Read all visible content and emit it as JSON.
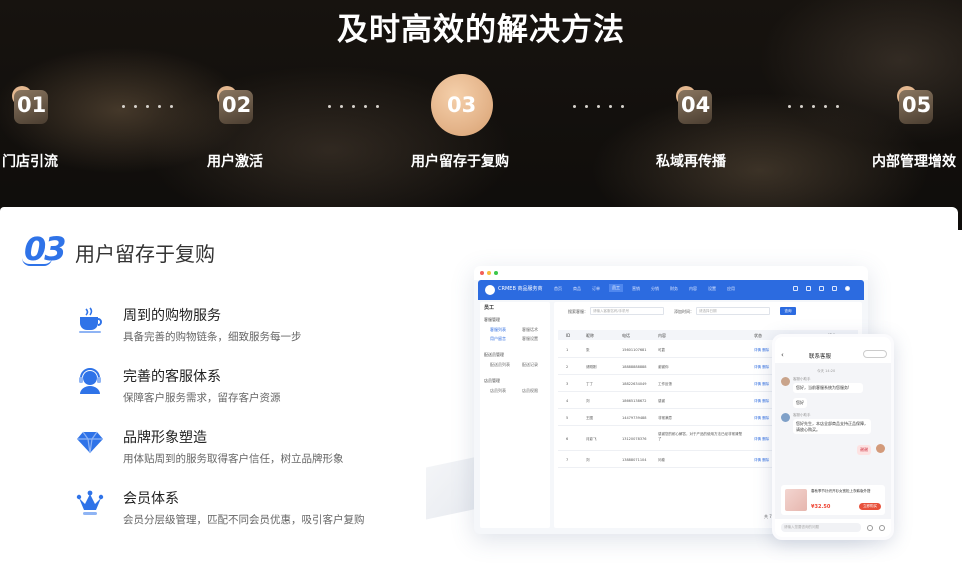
{
  "hero": {
    "title": "及时高效的解决方法",
    "steps": [
      {
        "num": "01",
        "label": "门店引流",
        "active": false
      },
      {
        "num": "02",
        "label": "用户激活",
        "active": false
      },
      {
        "num": "03",
        "label": "用户留存于复购",
        "active": true
      },
      {
        "num": "04",
        "label": "私域再传播",
        "active": false
      },
      {
        "num": "05",
        "label": "内部管理增效",
        "active": false
      }
    ],
    "colors": {
      "accent": "#e4b48a",
      "background": "#14110e"
    }
  },
  "panel": {
    "number": "03",
    "title": "用户留存于复购",
    "accent": "#2f73e8",
    "features": [
      {
        "icon": "coffee-cup-icon",
        "title": "周到的购物服务",
        "desc": "具备完善的购物链条，细致服务每一步"
      },
      {
        "icon": "customer-service-icon",
        "title": "完善的客服体系",
        "desc": "保障客户服务需求，留存客户资源"
      },
      {
        "icon": "diamond-icon",
        "title": "品牌形象塑造",
        "desc": "用体贴周到的服务取得客户信任，树立品牌形象"
      },
      {
        "icon": "crown-icon",
        "title": "会员体系",
        "desc": "会员分层级管理，匹配不同会员优惠，吸引客户复购"
      }
    ]
  },
  "desktop_mock": {
    "brand": "CRMEB 商品服务商",
    "nav": [
      "首页",
      "商品",
      "订单",
      "员工",
      "营销",
      "分销",
      "财务",
      "内容",
      "设置",
      "应用"
    ],
    "active_nav": "员工",
    "sidebar_title": "员工",
    "sidebar_groups": [
      {
        "label": "客服管理",
        "items": [
          "客服列表",
          "客服话术",
          "用户留言",
          "客服设置"
        ]
      },
      {
        "label": "配送员管理",
        "items": [
          "配送员列表",
          "配送记录"
        ]
      },
      {
        "label": "店员管理",
        "items": [
          "店员列表",
          "店员权限"
        ]
      }
    ],
    "search": {
      "label1": "搜索客服：",
      "placeholder1": "请输入客服名称/手机号",
      "label2": "添加时间：",
      "placeholder2": "请选择日期",
      "button": "查询"
    },
    "columns": [
      "ID",
      "昵称",
      "电话",
      "内容",
      "状态",
      "操作"
    ],
    "rows": [
      {
        "id": "1",
        "name": "张",
        "phone": "15601107681",
        "content": "可靠",
        "action": "详情 删除"
      },
      {
        "id": "2",
        "name": "请刚刚",
        "phone": "18888888888",
        "content": "谢谢你",
        "action": "详情 删除"
      },
      {
        "id": "3",
        "name": "丁丁",
        "phone": "18822634049",
        "content": "工作反馈",
        "action": "详情 删除"
      },
      {
        "id": "4",
        "name": "刘",
        "phone": "18665138672",
        "content": "感谢",
        "action": "详情 删除"
      },
      {
        "id": "5",
        "name": "王图",
        "phone": "14479739488",
        "content": "非常满意",
        "action": "详情 删除"
      },
      {
        "id": "6",
        "name": "月影飞",
        "phone": "13120078376",
        "content": "感谢您的耐心解答，对于产品的使用方法已经非常清楚了",
        "action": "详情 删除"
      },
      {
        "id": "7",
        "name": "刘",
        "phone": "13888071104",
        "content": "问卷",
        "action": "详情 删除"
      }
    ],
    "pager": "共 7 条"
  },
  "phone_mock": {
    "title": "联系客服",
    "time": "今天 14:20",
    "agent_name": "客服小助手",
    "messages": [
      {
        "from": "agent",
        "text": "您好，当前客服系统为您服务!"
      },
      {
        "from": "agent",
        "text": "您好"
      },
      {
        "from": "agent",
        "text": "您好先生，本店全部商品支持正品保障，请放心购买。"
      },
      {
        "from": "user",
        "text": "谢谢"
      }
    ],
    "product": {
      "text": "春秋季节针织开衫女宽松上衣韩版外搭",
      "price": "¥32.50",
      "button": "立即购买"
    },
    "input_placeholder": "请输入您要咨询的问题"
  }
}
